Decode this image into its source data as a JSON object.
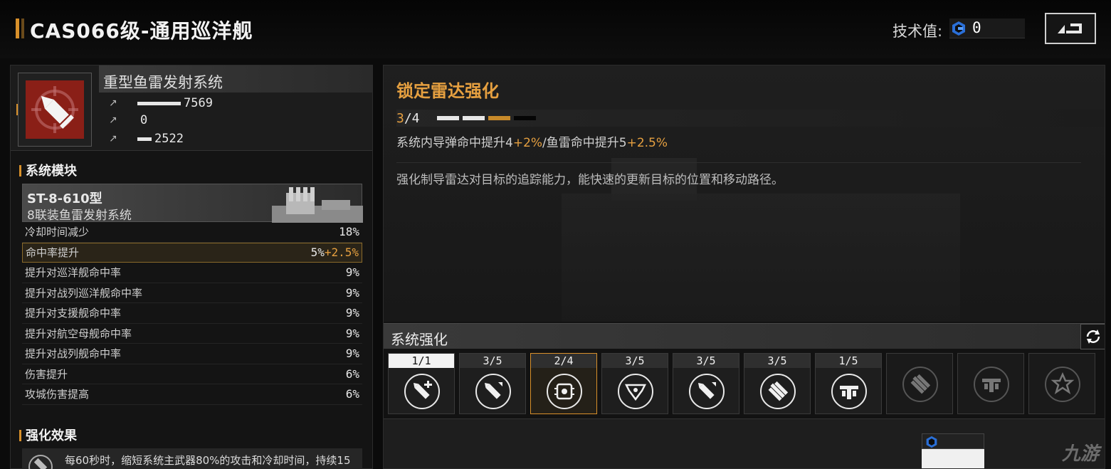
{
  "header": {
    "title": "CAS066级-通用巡洋舰",
    "tech_label": "技术值:",
    "tech_value": "0",
    "tech_icon": "tech-point-icon",
    "back_icon": "back-arrow-icon"
  },
  "weapon": {
    "name": "重型鱼雷发射系统",
    "stats": [
      {
        "icon": "damage-icon",
        "value": "7569",
        "fill": 0.55
      },
      {
        "icon": "rate-icon",
        "value": "0",
        "fill": 0.0
      },
      {
        "icon": "range-icon",
        "value": "2522",
        "fill": 0.18
      }
    ]
  },
  "modules": {
    "section_title": "系统模块",
    "card_name": "ST-8-610型",
    "card_sub": "8联装鱼雷发射系统",
    "rows": [
      {
        "label": "冷却时间减少",
        "value": "18%",
        "bonus": ""
      },
      {
        "label": "命中率提升",
        "value": "5%",
        "bonus": "+2.5%"
      },
      {
        "label": "提升对巡洋舰命中率",
        "value": "9%",
        "bonus": ""
      },
      {
        "label": "提升对战列巡洋舰命中率",
        "value": "9%",
        "bonus": ""
      },
      {
        "label": "提升对支援舰命中率",
        "value": "9%",
        "bonus": ""
      },
      {
        "label": "提升对航空母舰命中率",
        "value": "9%",
        "bonus": ""
      },
      {
        "label": "提升对战列舰命中率",
        "value": "9%",
        "bonus": ""
      },
      {
        "label": "伤害提升",
        "value": "6%",
        "bonus": ""
      },
      {
        "label": "攻城伤害提高",
        "value": "6%",
        "bonus": ""
      }
    ]
  },
  "effect": {
    "section_title": "强化效果",
    "text": "每60秒时，缩短系统主武器80%的攻击和冷却时间，持续15"
  },
  "detail": {
    "title": "锁定雷达强化",
    "level_current": "3",
    "level_max": "/4",
    "pips": [
      "full",
      "full",
      "cur",
      "empty"
    ],
    "line1_a": "系统内导弹命中提升4",
    "line1_b": "+2%",
    "line1_c": "/鱼雷命中提升5",
    "line1_d": "+2.5%",
    "line2": "强化制导雷达对目标的追踪能力，能快速的更新目标的位置和移动路径。"
  },
  "upgrades": {
    "title": "系统强化",
    "refresh_icon": "refresh-icon",
    "slots": [
      {
        "level": "1/1",
        "state": "done",
        "icon": "torpedo-plus-icon"
      },
      {
        "level": "3/5",
        "state": "normal",
        "icon": "torpedo-up-icon"
      },
      {
        "level": "2/4",
        "state": "active",
        "icon": "radar-chip-icon"
      },
      {
        "level": "3/5",
        "state": "normal",
        "icon": "armor-emblem-icon"
      },
      {
        "level": "3/5",
        "state": "normal",
        "icon": "torpedo-up-icon"
      },
      {
        "level": "3/5",
        "state": "normal",
        "icon": "torpedo-multi-icon"
      },
      {
        "level": "1/5",
        "state": "normal",
        "icon": "wing-emblem-icon"
      },
      {
        "level": "",
        "state": "locked",
        "icon": "torpedo-multi-icon"
      },
      {
        "level": "",
        "state": "locked",
        "icon": "wing-emblem-icon"
      },
      {
        "level": "",
        "state": "locked",
        "icon": "burst-emblem-icon"
      }
    ]
  },
  "watermark": "九游",
  "colors": {
    "accent": "#e6a040",
    "weapon_bg": "#8a1f17",
    "highlight_border": "#8a6a2a"
  }
}
